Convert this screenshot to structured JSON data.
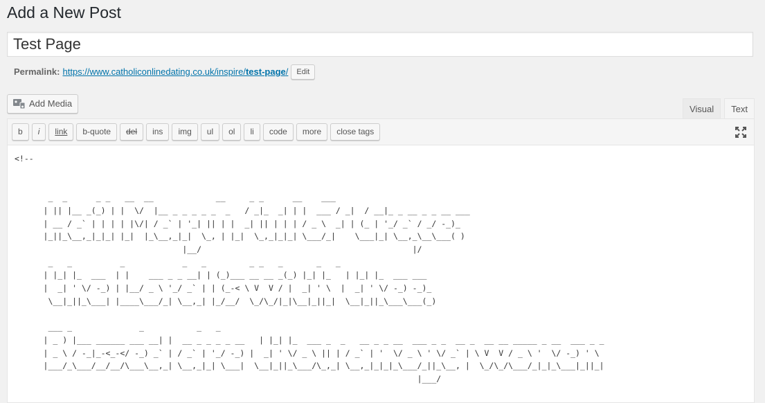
{
  "page_title": "Add a New Post",
  "post_title": "Test Page",
  "permalink": {
    "label": "Permalink:",
    "url_base": "https://www.catholiconlinedating.co.uk/inspire/",
    "slug": "test-page",
    "trail": "/",
    "edit_label": "Edit"
  },
  "add_media_label": "Add Media",
  "tabs": {
    "visual": "Visual",
    "text": "Text"
  },
  "quicktags": [
    "b",
    "i",
    "link",
    "b-quote",
    "del",
    "ins",
    "img",
    "ul",
    "ol",
    "li",
    "code",
    "more",
    "close tags"
  ],
  "editor_content": "<!--\n\n\n       _  _      _ _   __  __             __     _ _      __    ___\n      | || |__ _(_) | |  \\/  |__ _ _ _ _ _  _   / _|_  _| | |  ___ / _|  / __|_ _ __ _ _ __ ___\n      | __ / _` | | | | |\\/| / _` | '_| || | |  _| || | | | / _ \\  _| | (_ | '_/ _` / _/ -_)_\n      |_||_\\__,_|_|_| |_|  |_\\__,_|_|  \\_, | |_|  \\_,_|_|_| \\___/_|    \\___|_| \\__,_\\__\\___( )\n                                   |__/                                            |/\n       _   _          _            _   _         _ _   _       _   _\n      | |_| |_  ___  | |    ___ _ _ __| | (_)___ __ __ _(_) |_| |_   | |_| |_  ___ ___\n      |  _| ' \\/ -_) | |__/ _ \\ '_/ _` | | (_-< \\ V  V / |  _| ' \\  |  _| ' \\/ -_) -_)_\n       \\__|_||_\\___| |____\\___/_| \\__,_| |_/__/  \\_/\\_/|_|\\__|_||_|  \\__|_||_\\___\\___(_)\n\n       ___ _              _           _   _\n      | _ ) |___ ______ ___ __| |  __ _ _ _ _ __   | |_| |_  ___ _  _   __ _ _ __  ___ _ _  __ _  __ __ _____ _ __  ___ _ _\n      | _ \\ / -_|_-<_-</ -_) _` | / _` | '_/ -_) |  _| ' \\/ _ \\ || | / _` | '  \\/ _ \\ ' \\/ _` | \\ V  V / _ \\ '  \\/ -_) ' \\\n      |___/_\\___/__/__/\\___\\__,_| \\__,_|_| \\___|  \\__|_||_\\___/\\_,_| \\__,_|_|_|_\\___/_||_\\__, |  \\_/\\_/\\___/_|_|_\\___|_||_|\n                                                                                    |___/"
}
